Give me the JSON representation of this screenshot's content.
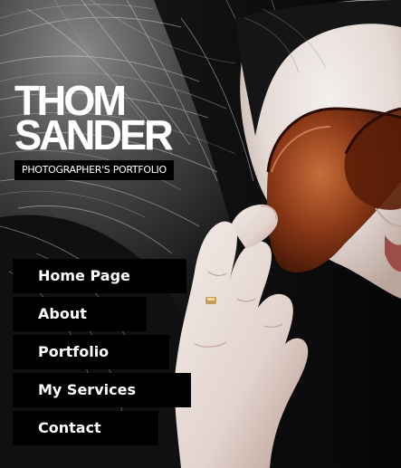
{
  "site": {
    "logo_line_1": "THOM",
    "logo_line_2": "SANDER",
    "tagline": "PHOTOGRAPHER'S PORTFOLIO"
  },
  "nav": {
    "items": [
      {
        "label": "Home Page"
      },
      {
        "label": "About"
      },
      {
        "label": "Portfolio"
      },
      {
        "label": "My Services"
      },
      {
        "label": "Contact"
      }
    ]
  },
  "colors": {
    "nav_background": "#000000",
    "text": "#ffffff"
  }
}
